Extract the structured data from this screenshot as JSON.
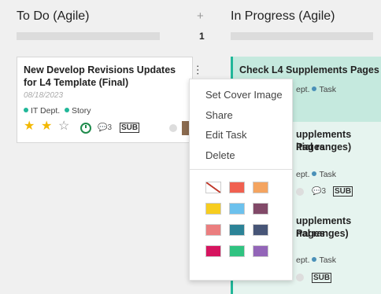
{
  "columns": [
    {
      "title": "To Do (Agile)",
      "count": "1"
    },
    {
      "title": "In Progress (Agile)"
    }
  ],
  "add_label": "+",
  "main_card": {
    "title": "New Develop Revisions Updates for L4 Template (Final)",
    "date": "08/18/2023",
    "tag1": "IT Dept.",
    "tag2": "Story",
    "stars": 2,
    "messages": "3",
    "sub": "SUB"
  },
  "right_cards": [
    {
      "title": "Check L4 Supplements Pages"
    },
    {
      "title_line1": "upplements Pages",
      "title_line2": "itial ranges)",
      "tag_a": "ept.",
      "tag_b": "Task",
      "messages": "3",
      "sub": "SUB"
    },
    {
      "title_line1": "upplements Pages",
      "title_line2": "nal ranges)",
      "tag_a": "ept.",
      "tag_b": "Task",
      "sub": "SUB"
    }
  ],
  "top_right_tags": {
    "a": "ept.",
    "b": "Task"
  },
  "menu": {
    "items": [
      "Set Cover Image",
      "Share",
      "Edit Task",
      "Delete"
    ]
  },
  "swatch_colors": [
    "#ffffff",
    "#f06050",
    "#f4a460",
    "#f7cd1f",
    "#6cc1ed",
    "#814968",
    "#eb7e7f",
    "#2c8397",
    "#475577",
    "#d6145f",
    "#30c381",
    "#9365b8"
  ],
  "accent": "#21b799"
}
